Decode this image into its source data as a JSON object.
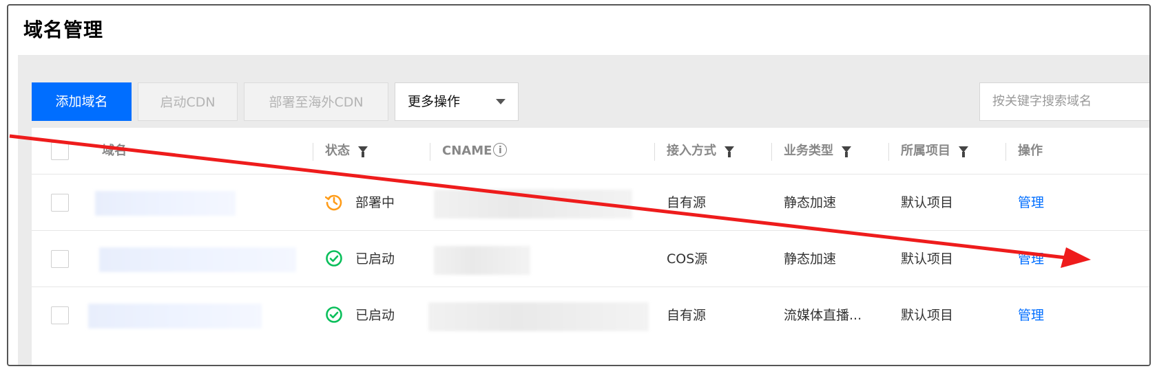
{
  "page": {
    "title": "域名管理"
  },
  "toolbar": {
    "add_domain": "添加域名",
    "enable_cdn": "启动CDN",
    "deploy_overseas": "部署至海外CDN",
    "more_actions": "更多操作",
    "search_placeholder": "按关键字搜索域名"
  },
  "table": {
    "columns": {
      "domain": "域名",
      "status": "状态",
      "cname": "CNAME",
      "access": "接入方式",
      "biz_type": "业务类型",
      "project": "所属项目",
      "actions": "操作"
    },
    "rows": [
      {
        "status": "部署中",
        "status_icon": "clock-orange-icon",
        "access": "自有源",
        "biz_type": "静态加速",
        "project": "默认项目",
        "action": "管理"
      },
      {
        "status": "已启动",
        "status_icon": "check-circle-green-icon",
        "access": "COS源",
        "biz_type": "静态加速",
        "project": "默认项目",
        "action": "管理"
      },
      {
        "status": "已启动",
        "status_icon": "check-circle-green-icon",
        "access": "自有源",
        "biz_type": "流媒体直播...",
        "project": "默认项目",
        "action": "管理"
      }
    ]
  },
  "colors": {
    "primary": "#006eff",
    "status_deploying": "#ff9c19",
    "status_ok": "#0abf5b",
    "annotation_arrow": "#ee1c1c"
  }
}
